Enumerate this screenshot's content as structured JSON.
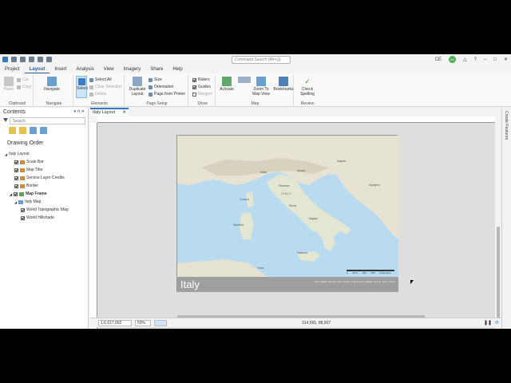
{
  "quick_access": {
    "search_placeholder": "Command Search (Alt+Q)",
    "user_initials": "CE",
    "avatar_initials": "IM"
  },
  "tabs": [
    "Project",
    "Layout",
    "Insert",
    "Analysis",
    "View",
    "Imagery",
    "Share",
    "Help"
  ],
  "ribbon": {
    "clipboard": {
      "paste": "Paste",
      "cut": "Cut",
      "copy": "Copy",
      "label": "Clipboard"
    },
    "navigate": {
      "navigate": "Navigate",
      "label": "Navigate"
    },
    "elements": {
      "select": "Select",
      "select_all": "Select All",
      "clear_selection": "Clear Selection",
      "delete": "Delete",
      "label": "Elements"
    },
    "page_setup": {
      "duplicate": "Duplicate",
      "layout": "Layout",
      "size": "Size",
      "orientation": "Orientation",
      "page_from_printer": "Page from Printer",
      "label": "Page Setup"
    },
    "show": {
      "rulers": "Rulers",
      "guides": "Guides",
      "margins": "Margins",
      "label": "Show"
    },
    "map": {
      "activate": "Activate",
      "zoom_to": "Zoom To",
      "map_view": "Map View",
      "bookmarks": "Bookmarks",
      "label": "Map"
    },
    "review": {
      "check": "Check",
      "spelling": "Spelling",
      "label": "Review"
    }
  },
  "contents": {
    "title": "Contents",
    "search_placeholder": "Search",
    "drawing_order": "Drawing Order",
    "layers": [
      {
        "name": "Italy Layout",
        "level": 0
      },
      {
        "name": "Scale Bar",
        "level": 1,
        "checked": true
      },
      {
        "name": "Map Title",
        "level": 1,
        "checked": true
      },
      {
        "name": "Service Layer Credits",
        "level": 1,
        "checked": true
      },
      {
        "name": "Border",
        "level": 1,
        "checked": true
      },
      {
        "name": "Map Frame",
        "level": 1,
        "checked": true,
        "bold": true
      },
      {
        "name": "Italy Map",
        "level": 2
      },
      {
        "name": "World Topographic Map",
        "level": 3,
        "checked": true
      },
      {
        "name": "World Hillshade",
        "level": 3,
        "checked": true
      }
    ]
  },
  "view": {
    "tab_label": "Italy Layout",
    "map_title": "Italy",
    "credits": "Esri, HERE, Garmin, FAO, NOAA, USGS, Esri, HERE, Garmin, FAO, NOAA",
    "scale_labels": [
      "0",
      "62.5",
      "125",
      "250"
    ],
    "scale_unit": "Kilometers",
    "places": [
      "ITALY",
      "Rome",
      "Naples",
      "Milan",
      "Venice",
      "Florence",
      "Palermo",
      "Sardinia",
      "Corsica",
      "Tunis",
      "Zagreb",
      "Sarajevo"
    ]
  },
  "side_panel": {
    "label": "Create Features"
  },
  "status": {
    "scale": "1:6,617,092",
    "zoom": "59%",
    "coords": "314,565, 88,907"
  }
}
